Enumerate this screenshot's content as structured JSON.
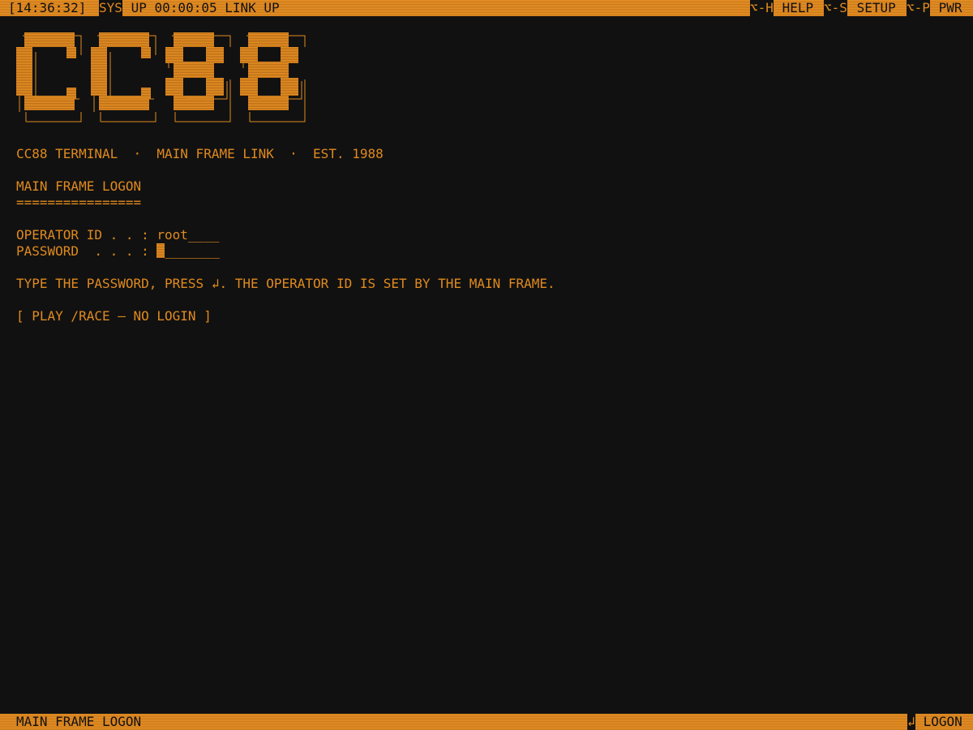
{
  "topbar": {
    "clock": "[14:36:32]",
    "sys_tag": "SYS",
    "status": " UP 00:00:05 LINK UP",
    "help_key": "⌥-H",
    "help_label": " HELP ",
    "setup_key": "⌥-S",
    "setup_label": " SETUP ",
    "power_key": "⌥-P",
    "power_label": " PWR"
  },
  "logo": {
    "text": "CC88"
  },
  "tagline": "CC88 TERMINAL  ·  MAIN FRAME LINK  ·  EST. 1988",
  "logon": {
    "title": "MAIN FRAME LOGON",
    "underline": "================",
    "operator_label": "OPERATOR ID . . : ",
    "operator_value": "root",
    "operator_pad": "____",
    "password_label": "PASSWORD  . . . : ",
    "password_pad": "_______",
    "hint": "TYPE THE PASSWORD, PRESS ↲. THE OPERATOR ID IS SET BY THE MAIN FRAME.",
    "play_link": "[ PLAY /RACE — NO LOGIN ]"
  },
  "bottombar": {
    "screen_name": "MAIN FRAME LOGON",
    "enter_key": "↲",
    "logon_label": " LOGON"
  },
  "colors": {
    "amber": "#e08a1e",
    "background": "#111111"
  }
}
